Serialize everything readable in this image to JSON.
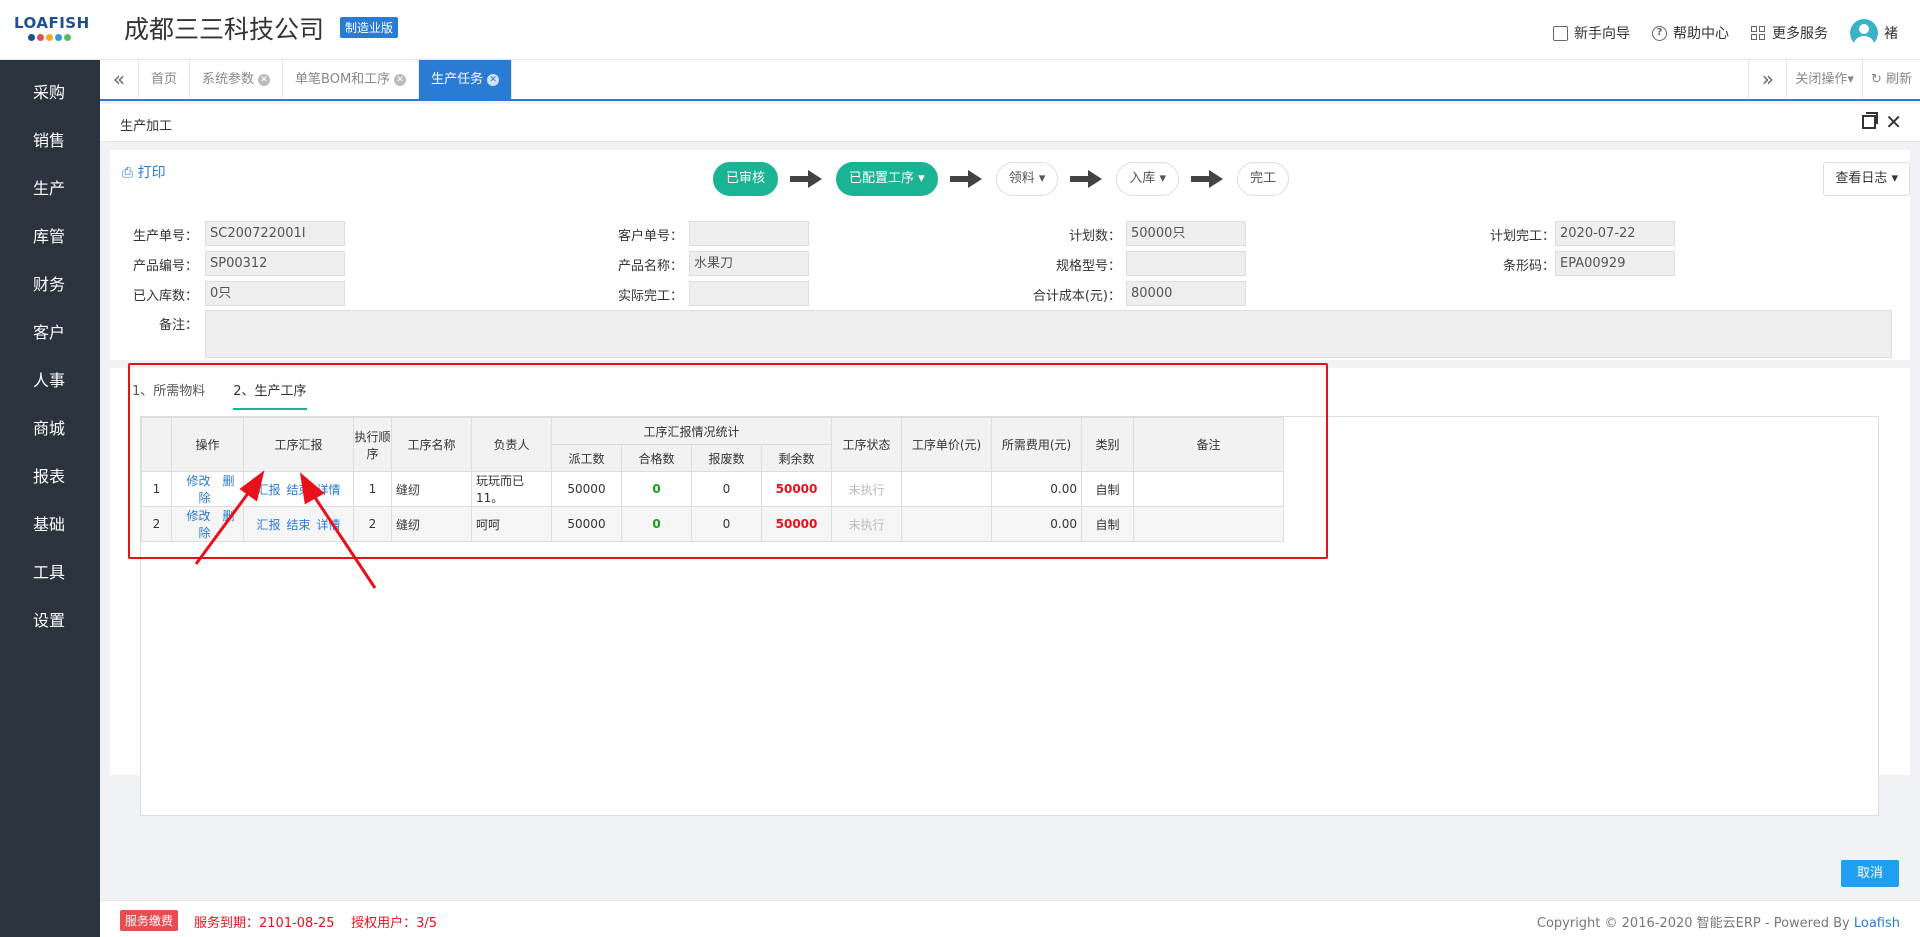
{
  "logo": {
    "text": "LOAFISH",
    "dot_colors": [
      "#1d4f91",
      "#e54d50",
      "#f7a823",
      "#2e9ad0",
      "#5cb85c"
    ]
  },
  "header": {
    "company": "成都三三科技公司",
    "edition": "制造业版",
    "links": [
      {
        "label": "新手向导",
        "icon": "book-icon"
      },
      {
        "label": "帮助中心",
        "icon": "help-icon"
      },
      {
        "label": "更多服务",
        "icon": "grid-icon"
      }
    ],
    "user": "褚"
  },
  "sidebar": {
    "items": [
      "采购",
      "销售",
      "生产",
      "库管",
      "财务",
      "客户",
      "人事",
      "商城",
      "报表",
      "基础",
      "工具",
      "设置"
    ]
  },
  "tabs": {
    "items": [
      {
        "label": "首页",
        "closable": false
      },
      {
        "label": "系统参数",
        "closable": true
      },
      {
        "label": "单笔BOM和工序",
        "closable": true
      },
      {
        "label": "生产任务",
        "closable": true,
        "active": true
      }
    ],
    "close_ops": "关闭操作",
    "refresh": "刷新"
  },
  "page": {
    "title": "生产加工"
  },
  "toolbar": {
    "print": "打印",
    "flow": [
      {
        "label": "已审核",
        "state": "done",
        "dropdown": false
      },
      {
        "label": "已配置工序",
        "state": "done",
        "dropdown": true
      },
      {
        "label": "领料",
        "state": "pending",
        "dropdown": true
      },
      {
        "label": "入库",
        "state": "pending",
        "dropdown": true
      },
      {
        "label": "完工",
        "state": "pending",
        "dropdown": false
      }
    ],
    "log": "查看日志"
  },
  "form": {
    "order_no_label": "生产单号：",
    "order_no": "SC200722001I",
    "customer_no_label": "客户单号：",
    "customer_no": "",
    "plan_qty_label": "计划数：",
    "plan_qty": "50000只",
    "plan_done_label": "计划完工：",
    "plan_done": "2020-07-22",
    "product_no_label": "产品编号：",
    "product_no": "SP00312",
    "product_name_label": "产品名称：",
    "product_name": "水果刀",
    "spec_label": "规格型号：",
    "spec": "",
    "barcode_label": "条形码：",
    "barcode": "EPA00929",
    "stocked_label": "已入库数：",
    "stocked": "0只",
    "actual_done_label": "实际完工：",
    "actual_done": "",
    "total_cost_label": "合计成本(元)：",
    "total_cost": "80000",
    "remark_label": "备注：",
    "remark": ""
  },
  "lower_tabs": [
    {
      "label": "1、所需物料",
      "active": false
    },
    {
      "label": "2、生产工序",
      "active": true
    }
  ],
  "table": {
    "headers": {
      "op": "操作",
      "report": "工序汇报",
      "seq": "执行顺序",
      "name": "工序名称",
      "owner": "负责人",
      "stats": "工序汇报情况统计",
      "dispatched": "派工数",
      "qualified": "合格数",
      "scrapped": "报废数",
      "remaining": "剩余数",
      "status": "工序状态",
      "unit_price": "工序单价(元)",
      "fee": "所需费用(元)",
      "category": "类别",
      "remark": "备注"
    },
    "op_links": [
      "修改",
      "删除"
    ],
    "report_links": [
      "汇报",
      "结束",
      "详情"
    ],
    "rows": [
      {
        "idx": "1",
        "seq": "1",
        "name": "缝纫",
        "owner": "玩玩而已11。",
        "dispatched": "50000",
        "qualified": "0",
        "scrapped": "0",
        "remaining": "50000",
        "status": "未执行",
        "unit_price": "",
        "fee": "0.00",
        "category": "自制",
        "remark": ""
      },
      {
        "idx": "2",
        "seq": "2",
        "name": "缝纫",
        "owner": "呵呵",
        "dispatched": "50000",
        "qualified": "0",
        "scrapped": "0",
        "remaining": "50000",
        "status": "未执行",
        "unit_price": "",
        "fee": "0.00",
        "category": "自制",
        "remark": ""
      }
    ]
  },
  "footer": {
    "cancel": "取消",
    "badge": "服务缴费",
    "service_text": "服务到期：2101-08-25    授权用户：3/5",
    "copyright": "Copyright © 2016-2020 智能云ERP - Powered By",
    "brand": "Loafish"
  }
}
